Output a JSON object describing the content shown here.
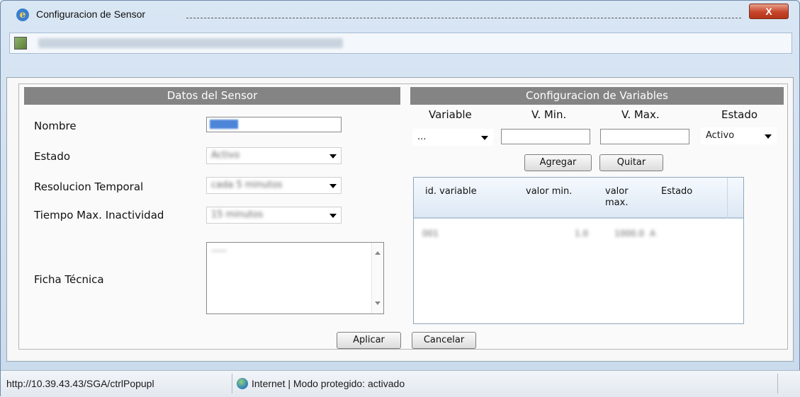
{
  "window": {
    "title": "Configuracion de Sensor",
    "close_label": "X",
    "address_url": "http://10.39.43.43/SGA/ctrlPopupAltaSensor.jsp?n=1&tp=1&w=1&idr=131528059007"
  },
  "sensor": {
    "header": "Datos del Sensor",
    "nombre_label": "Nombre",
    "nombre_value": "",
    "estado_label": "Estado",
    "estado_value": "Activo",
    "resolucion_label": "Resolucion Temporal",
    "resolucion_value": "cada 5 minutos",
    "tiempo_label": "Tiempo Max. Inactividad",
    "tiempo_value": "15 minutos",
    "ficha_label": "Ficha Técnica",
    "ficha_value": "-----"
  },
  "variables": {
    "header": "Configuracion de Variables",
    "variable_label": "Variable",
    "vmin_label": "V. Min.",
    "vmax_label": "V. Max.",
    "estado_label": "Estado",
    "variable_value": "...",
    "estado_value": "Activo",
    "agregar_label": "Agregar",
    "quitar_label": "Quitar",
    "grid": {
      "columns": [
        "id. variable",
        "valor min.",
        "valor max.",
        "Estado"
      ],
      "rows": [
        [
          "001",
          "1.0",
          "1000.0",
          "A"
        ]
      ]
    }
  },
  "actions": {
    "aplicar_label": "Aplicar",
    "cancelar_label": "Cancelar"
  },
  "status": {
    "url": "http://10.39.43.43/SGA/ctrlPopupl",
    "zone": "Internet | Modo protegido: activado"
  }
}
